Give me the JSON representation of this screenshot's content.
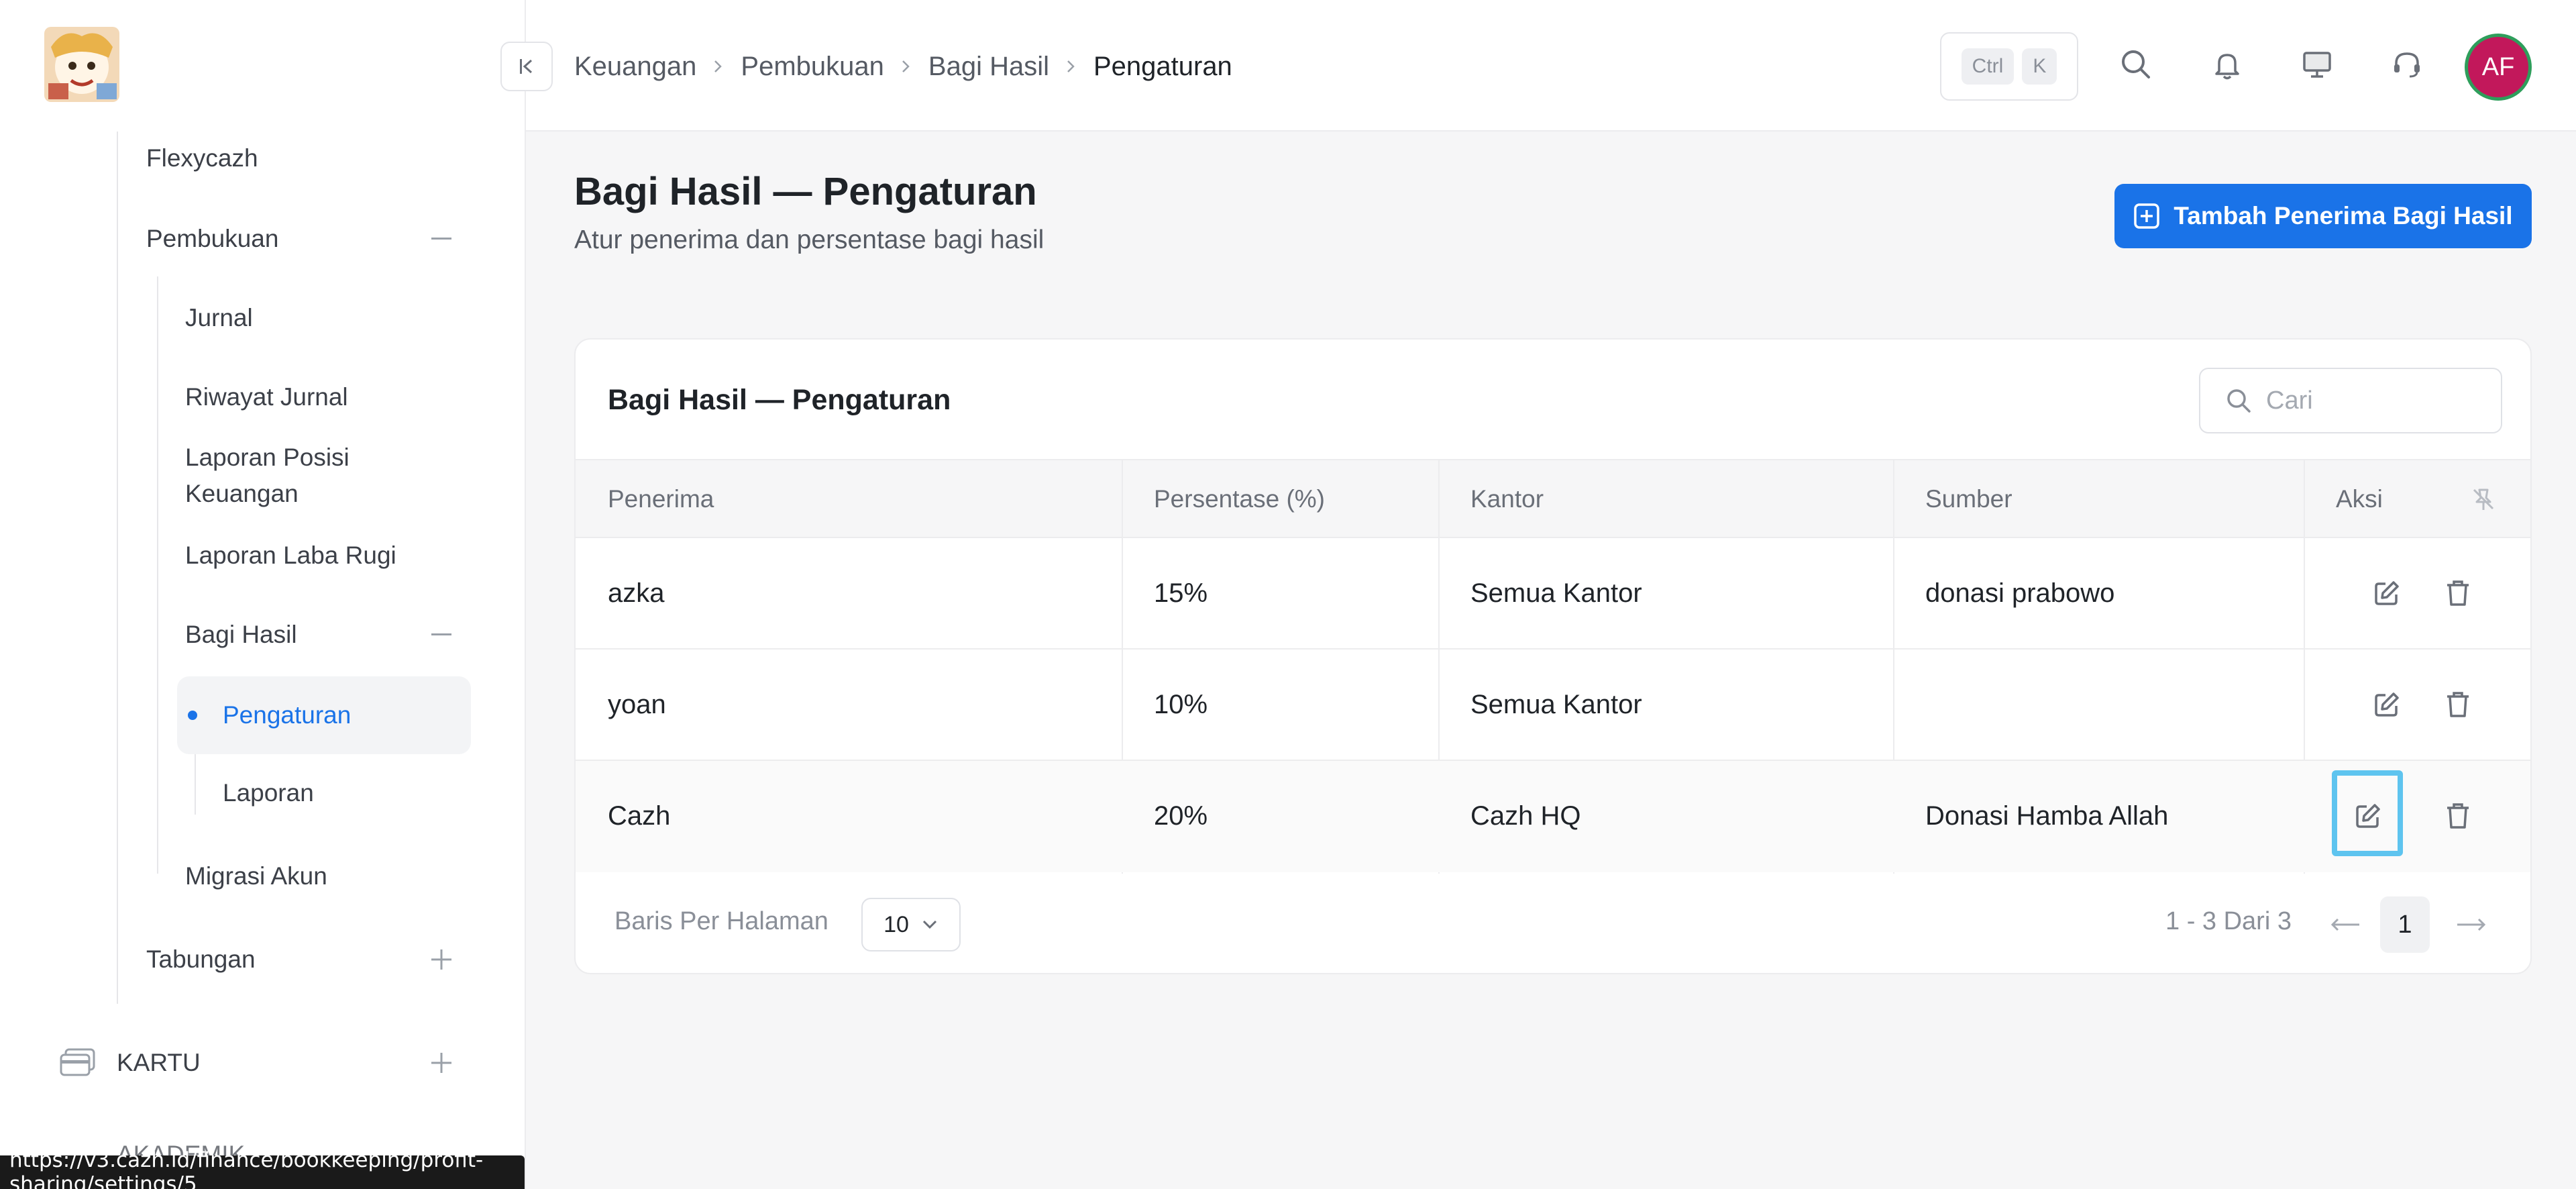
{
  "sidebar": {
    "items": {
      "flexycazh": "Flexycazh",
      "pembukuan": "Pembukuan",
      "jurnal": "Jurnal",
      "riwayat_jurnal": "Riwayat Jurnal",
      "laporan_posisi_keuangan_line1": "Laporan Posisi",
      "laporan_posisi_keuangan_line2": "Keuangan",
      "laporan_laba_rugi": "Laporan Laba Rugi",
      "bagi_hasil": "Bagi Hasil",
      "pengaturan": "Pengaturan",
      "laporan": "Laporan",
      "migrasi_akun": "Migrasi Akun",
      "tabungan": "Tabungan",
      "kartu": "KARTU",
      "akademik": "AKADEMIK"
    },
    "active_item": "Pengaturan"
  },
  "status_bar": {
    "url": "https://v3.cazh.id/finance/bookkeeping/profit-sharing/settings/5"
  },
  "topbar": {
    "breadcrumb": [
      "Keuangan",
      "Pembukuan",
      "Bagi Hasil",
      "Pengaturan"
    ],
    "shortcut_keys": [
      "Ctrl",
      "K"
    ],
    "avatar_initials": "AF"
  },
  "page": {
    "title": "Bagi Hasil — Pengaturan",
    "subtitle": "Atur penerima dan persentase bagi hasil",
    "add_button_label": "Tambah Penerima Bagi Hasil"
  },
  "card": {
    "title": "Bagi Hasil — Pengaturan",
    "search_placeholder": "Cari",
    "columns": [
      "Penerima",
      "Persentase (%)",
      "Kantor",
      "Sumber",
      "Aksi"
    ],
    "rows": [
      {
        "penerima": "azka",
        "persentase": "15%",
        "kantor": "Semua Kantor",
        "sumber": "donasi prabowo"
      },
      {
        "penerima": "yoan",
        "persentase": "10%",
        "kantor": "Semua Kantor",
        "sumber": ""
      },
      {
        "penerima": "Cazh",
        "persentase": "20%",
        "kantor": "Cazh HQ",
        "sumber": "Donasi Hamba Allah"
      }
    ],
    "footer": {
      "per_page_label": "Baris Per Halaman",
      "per_page_value": "10",
      "range_text": "1 - 3 Dari 3",
      "current_page": "1"
    }
  },
  "colors": {
    "accent": "#1a73e8",
    "avatar_bg": "#c2185b",
    "avatar_ring": "#2e9e5b",
    "focus_ring": "#5ec4ef"
  }
}
